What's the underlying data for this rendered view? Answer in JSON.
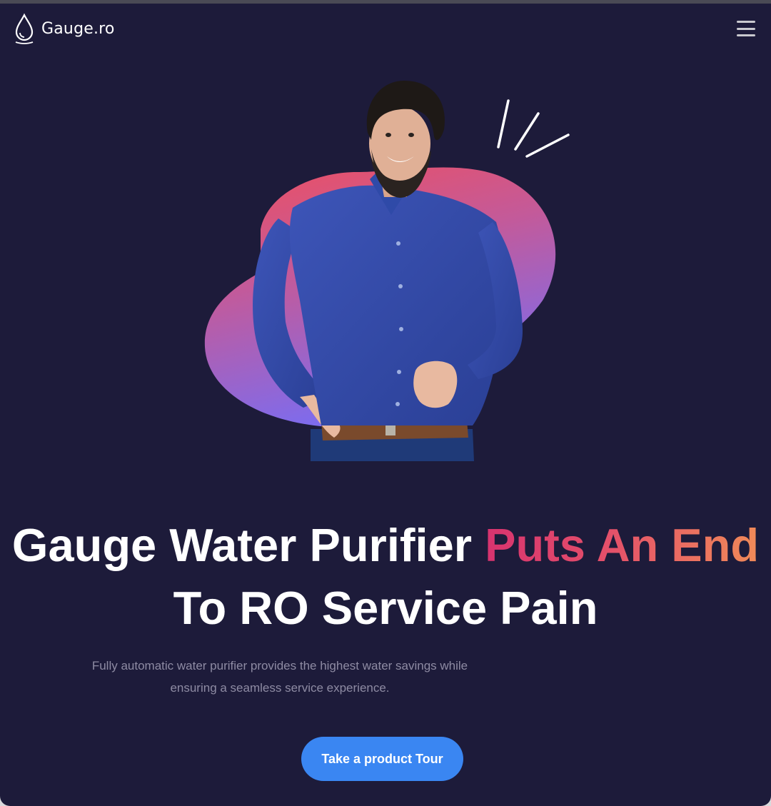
{
  "header": {
    "brand": "Gauge.ro",
    "logo_icon": "water-drop-icon",
    "menu_icon": "hamburger-menu-icon"
  },
  "hero": {
    "headline_part1": "Gauge Water Purifier ",
    "headline_accent": "Puts An End",
    "headline_part2": "To RO Service Pain",
    "subtext": "Fully automatic water purifier provides the highest water savings while ensuring a seamless service experience.",
    "cta_label": "Take a product Tour"
  },
  "colors": {
    "background": "#1d1b3a",
    "accent_start": "#d7336f",
    "accent_end": "#f08a58",
    "cta": "#3a86f2",
    "blob_top": "#ef4f5f",
    "blob_bottom": "#7b6cf0"
  }
}
